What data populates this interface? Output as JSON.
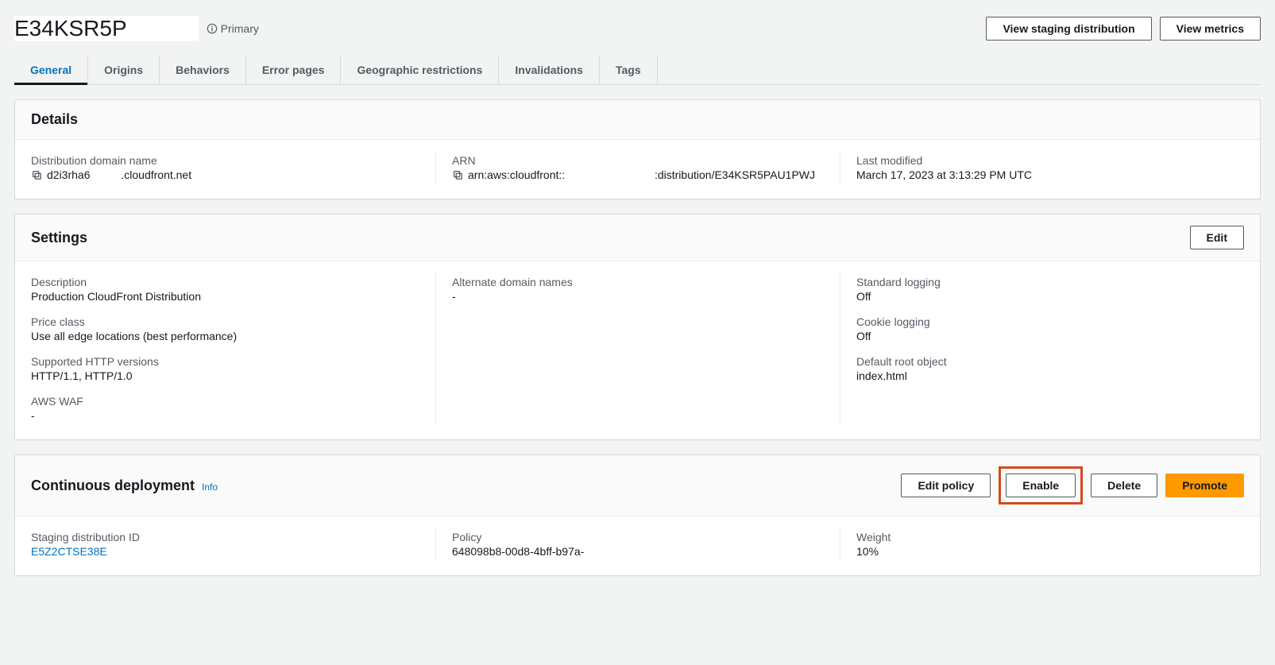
{
  "header": {
    "distribution_id": "E34KSR5P",
    "primary_label": "Primary",
    "actions": {
      "view_staging": "View staging distribution",
      "view_metrics": "View metrics"
    }
  },
  "tabs": {
    "general": "General",
    "origins": "Origins",
    "behaviors": "Behaviors",
    "error_pages": "Error pages",
    "geo": "Geographic restrictions",
    "invalidations": "Invalidations",
    "tags": "Tags"
  },
  "details": {
    "title": "Details",
    "domain_label": "Distribution domain name",
    "domain_value": "d2i3rha6          .cloudfront.net",
    "arn_label": "ARN",
    "arn_value": "arn:aws:cloudfront::                             :distribution/E34KSR5PAU1PWJ",
    "modified_label": "Last modified",
    "modified_value": "March 17, 2023 at 3:13:29 PM UTC"
  },
  "settings": {
    "title": "Settings",
    "edit": "Edit",
    "description_label": "Description",
    "description_value": "Production CloudFront Distribution",
    "price_label": "Price class",
    "price_value": "Use all edge locations (best performance)",
    "http_label": "Supported HTTP versions",
    "http_value": "HTTP/1.1, HTTP/1.0",
    "waf_label": "AWS WAF",
    "waf_value": "-",
    "altdomain_label": "Alternate domain names",
    "altdomain_value": "-",
    "stdlog_label": "Standard logging",
    "stdlog_value": "Off",
    "cookielog_label": "Cookie logging",
    "cookielog_value": "Off",
    "root_label": "Default root object",
    "root_value": "index.html"
  },
  "cd": {
    "title": "Continuous deployment",
    "info": "Info",
    "edit_policy": "Edit policy",
    "enable": "Enable",
    "delete": "Delete",
    "promote": "Promote",
    "staging_label": "Staging distribution ID",
    "staging_value": "E5Z2CTSE38E",
    "policy_label": "Policy",
    "policy_value": "648098b8-00d8-4bff-b97a-",
    "weight_label": "Weight",
    "weight_value": "10%"
  }
}
